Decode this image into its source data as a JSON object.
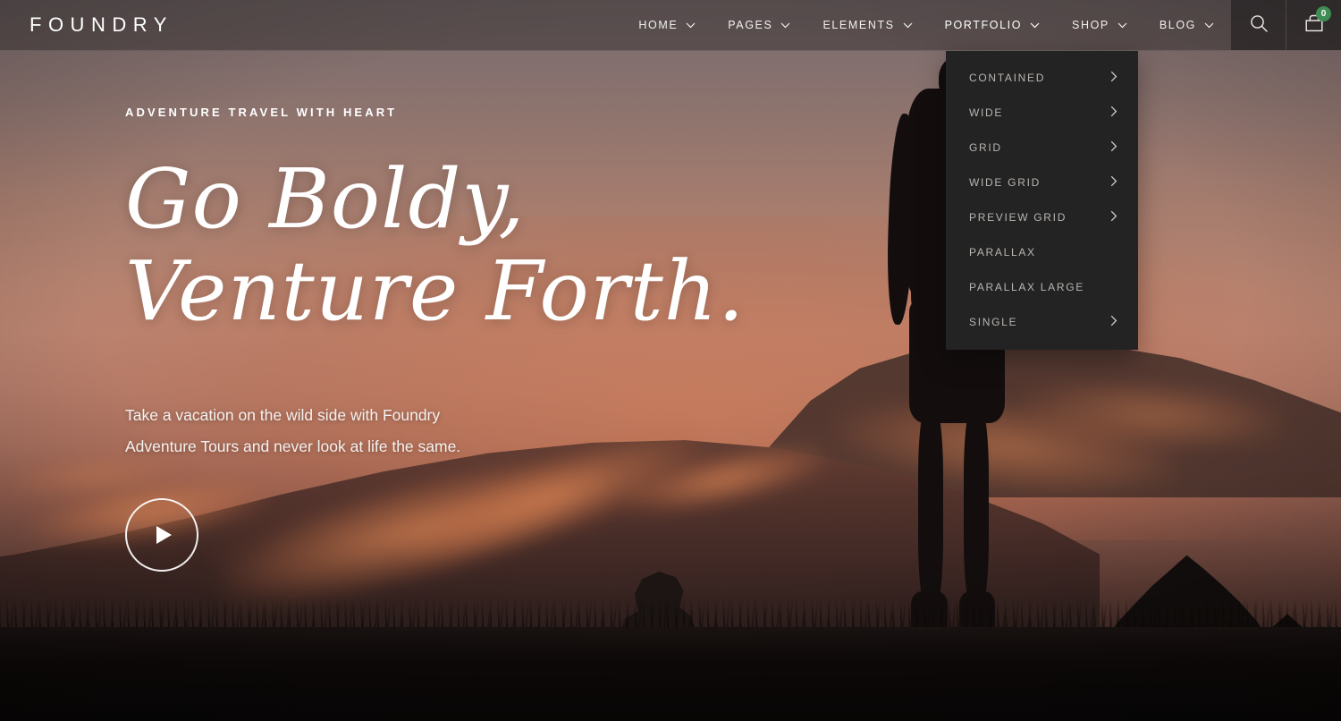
{
  "header": {
    "logo": "FOUNDRY",
    "nav": [
      {
        "label": "HOME",
        "icon": "chevron-down-icon",
        "has_caret": true
      },
      {
        "label": "PAGES",
        "icon": "chevron-down-icon",
        "has_caret": true
      },
      {
        "label": "ELEMENTS",
        "icon": "chevron-down-icon",
        "has_caret": true
      },
      {
        "label": "PORTFOLIO",
        "icon": "chevron-down-icon",
        "has_caret": true
      },
      {
        "label": "SHOP",
        "icon": "chevron-down-icon",
        "has_caret": true
      },
      {
        "label": "BLOG",
        "icon": "chevron-down-icon",
        "has_caret": true
      }
    ],
    "search_icon": "search-icon",
    "cart_icon": "cart-icon",
    "cart_count": "0",
    "cart_badge_color": "#3f8c54"
  },
  "portfolio_dropdown": {
    "open_for": "PORTFOLIO",
    "items": [
      {
        "label": "CONTAINED",
        "has_submenu": true
      },
      {
        "label": "WIDE",
        "has_submenu": true
      },
      {
        "label": "GRID",
        "has_submenu": true
      },
      {
        "label": "WIDE GRID",
        "has_submenu": true
      },
      {
        "label": "PREVIEW GRID",
        "has_submenu": true
      },
      {
        "label": "PARALLAX",
        "has_submenu": false
      },
      {
        "label": "PARALLAX LARGE",
        "has_submenu": false
      },
      {
        "label": "SINGLE",
        "has_submenu": true
      }
    ],
    "submenu_icon": "chevron-right-icon",
    "background_color": "#232323",
    "text_color": "#b9b5b1"
  },
  "hero": {
    "eyebrow": "ADVENTURE TRAVEL WITH HEART",
    "headline_line1": "Go Boldy,",
    "headline_line2": "Venture Forth.",
    "subtitle": "Take a vacation on the wild side with Foundry Adventure Tours and never look at life the same.",
    "play_button_icon": "play-icon",
    "text_color": "#ffffff",
    "background_description": "sunset-hiker-silhouette-photo"
  }
}
